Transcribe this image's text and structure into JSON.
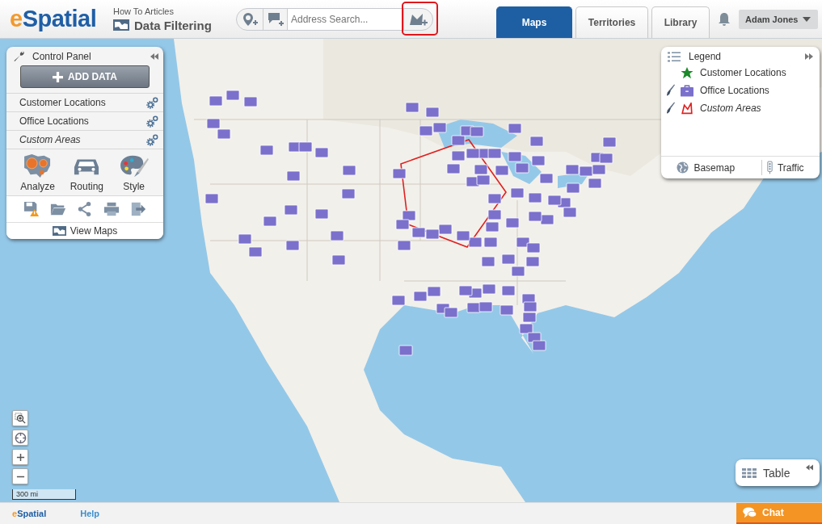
{
  "header": {
    "logo": "eSpatial",
    "breadcrumb": "How To Articles",
    "page_title": "Data Filtering",
    "search": {
      "placeholder": "Address Search..."
    },
    "add_area_button": {
      "highlighted": true
    },
    "tabs": [
      {
        "label": "Maps",
        "selected": true
      },
      {
        "label": "Territories",
        "selected": false
      },
      {
        "label": "Library",
        "selected": false
      }
    ],
    "user": "Adam Jones"
  },
  "control_panel": {
    "title": "Control Panel",
    "add_button": "ADD DATA",
    "layers": [
      {
        "name": "Customer Locations",
        "italic": false
      },
      {
        "name": "Office Locations",
        "italic": false
      },
      {
        "name": "Custom Areas",
        "italic": true
      }
    ],
    "tools": [
      {
        "kind": "analyze",
        "label": "Analyze"
      },
      {
        "kind": "routing",
        "label": "Routing"
      },
      {
        "kind": "style",
        "label": "Style"
      }
    ],
    "view_maps": "View Maps"
  },
  "legend": {
    "title": "Legend",
    "items": [
      {
        "kind": "star",
        "label": "Customer Locations",
        "italic": false,
        "editable": false
      },
      {
        "kind": "briefcase",
        "label": "Office Locations",
        "italic": false,
        "editable": true
      },
      {
        "kind": "area",
        "label": "Custom Areas",
        "italic": true,
        "editable": true
      }
    ],
    "buttons": [
      "Basemap",
      "Traffic"
    ]
  },
  "scale": "300 mi",
  "table_button": "Table",
  "footer": {
    "logo": "eSpatial",
    "help": "Help",
    "chat": "Chat"
  }
}
